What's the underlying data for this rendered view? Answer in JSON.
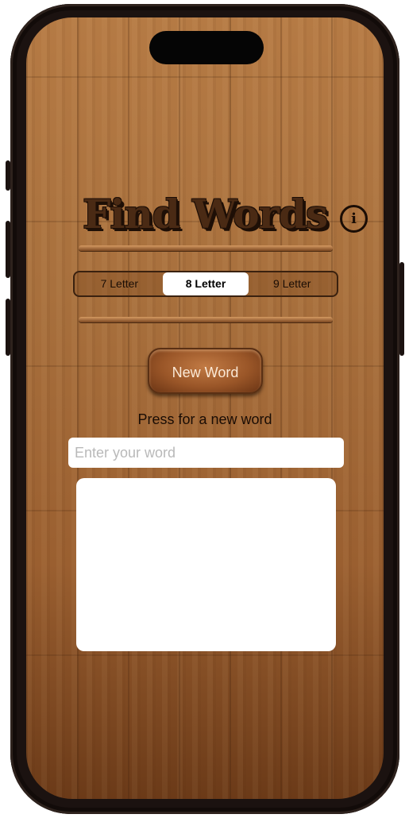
{
  "app": {
    "title": "Find Words",
    "info_icon": "info-circle-icon"
  },
  "letter_selector": {
    "options": [
      "7 Letter",
      "8 Letter",
      "9 Letter"
    ],
    "selected": "8 Letter"
  },
  "new_word_button": {
    "label": "New Word"
  },
  "hint_text": "Press for a new word",
  "word_input": {
    "value": "",
    "placeholder": "Enter your word"
  },
  "results": {
    "items": []
  },
  "colors": {
    "wood_light": "#b57a44",
    "wood_dark": "#6b3a18",
    "title_dark": "#1e0f06",
    "selected_segment": "#ffffff"
  }
}
